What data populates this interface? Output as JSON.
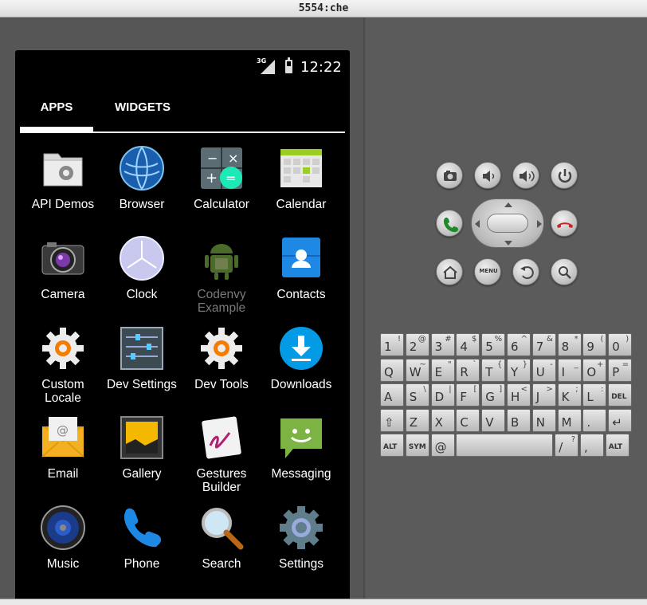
{
  "window": {
    "title": "5554:che"
  },
  "status_bar": {
    "network": "3G",
    "time": "12:22"
  },
  "tabs": [
    {
      "label": "APPS"
    },
    {
      "label": "WIDGETS"
    }
  ],
  "apps": [
    {
      "label": "API Demos",
      "icon": "folder-gear-icon"
    },
    {
      "label": "Browser",
      "icon": "globe-icon"
    },
    {
      "label": "Calculator",
      "icon": "calculator-icon"
    },
    {
      "label": "Calendar",
      "icon": "calendar-icon"
    },
    {
      "label": "Camera",
      "icon": "camera-icon"
    },
    {
      "label": "Clock",
      "icon": "clock-icon"
    },
    {
      "label": "Codenvy Example",
      "icon": "android-robot-icon"
    },
    {
      "label": "Contacts",
      "icon": "contacts-icon"
    },
    {
      "label": "Custom Locale",
      "icon": "gear-icon"
    },
    {
      "label": "Dev Settings",
      "icon": "sliders-icon"
    },
    {
      "label": "Dev Tools",
      "icon": "gear-icon"
    },
    {
      "label": "Downloads",
      "icon": "download-icon"
    },
    {
      "label": "Email",
      "icon": "envelope-icon"
    },
    {
      "label": "Gallery",
      "icon": "picture-icon"
    },
    {
      "label": "Gestures Builder",
      "icon": "gestures-icon"
    },
    {
      "label": "Messaging",
      "icon": "chat-bubble-icon"
    },
    {
      "label": "Music",
      "icon": "speaker-icon"
    },
    {
      "label": "Phone",
      "icon": "phone-icon"
    },
    {
      "label": "Search",
      "icon": "magnifier-icon"
    },
    {
      "label": "Settings",
      "icon": "settings-gear-icon"
    }
  ],
  "hardware_buttons": {
    "menu": "MENU"
  },
  "keyboard": {
    "row1": [
      [
        "1",
        "!"
      ],
      [
        "2",
        "@"
      ],
      [
        "3",
        "#"
      ],
      [
        "4",
        "$"
      ],
      [
        "5",
        "%"
      ],
      [
        "6",
        "^"
      ],
      [
        "7",
        "&"
      ],
      [
        "8",
        "*"
      ],
      [
        "9",
        "("
      ],
      [
        "0",
        ")"
      ]
    ],
    "row2": [
      [
        "Q",
        ""
      ],
      [
        "W",
        "~"
      ],
      [
        "E",
        "\""
      ],
      [
        "R",
        "`"
      ],
      [
        "T",
        "{"
      ],
      [
        "Y",
        "}"
      ],
      [
        "U",
        "-"
      ],
      [
        "I",
        "_"
      ],
      [
        "O",
        "+"
      ],
      [
        "P",
        "="
      ]
    ],
    "row3": [
      [
        "A",
        ""
      ],
      [
        "S",
        "\\"
      ],
      [
        "D",
        "|"
      ],
      [
        "F",
        "["
      ],
      [
        "G",
        "]"
      ],
      [
        "H",
        "<"
      ],
      [
        "J",
        ">"
      ],
      [
        "K",
        ";"
      ],
      [
        "L",
        ":"
      ],
      [
        "DEL",
        ""
      ]
    ],
    "row4": [
      [
        "⇧",
        ""
      ],
      [
        "Z",
        ""
      ],
      [
        "X",
        ""
      ],
      [
        "C",
        ""
      ],
      [
        "V",
        ""
      ],
      [
        "B",
        ""
      ],
      [
        "N",
        ""
      ],
      [
        "M",
        ""
      ],
      [
        ".",
        ""
      ],
      [
        "↵",
        ""
      ]
    ],
    "row5": [
      [
        "ALT",
        ""
      ],
      [
        "SYM",
        ""
      ],
      [
        "@",
        ""
      ],
      [
        "",
        ""
      ],
      [
        "/",
        "?"
      ],
      [
        ",",
        ""
      ],
      [
        "ALT",
        ""
      ]
    ]
  }
}
